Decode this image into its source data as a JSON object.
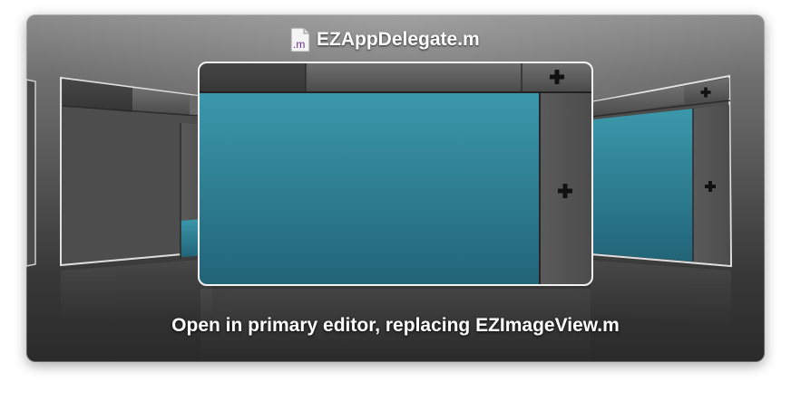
{
  "title_bar": {
    "file_icon": "objc-m-file-icon",
    "file_icon_label": ".m",
    "file_name": "EZAppDelegate.m"
  },
  "layouts": [
    {
      "name": "side-by-side-editor-layout",
      "position": "left",
      "editor_color": "#2f8ea1"
    },
    {
      "name": "primary-editor-layout",
      "position": "center",
      "selected": true,
      "editor_color": "#2f8ea1"
    },
    {
      "name": "assistant-editor-layout",
      "position": "right",
      "editor_color": "#2f8ea1"
    }
  ],
  "icons": {
    "add_tab": "plus-icon",
    "add_split": "plus-icon"
  },
  "colors": {
    "editor_teal": "#2f8ea1",
    "panel_dark": "#2a2a2a",
    "chrome_gray": "#5a5a5a"
  },
  "status": {
    "message": "Open in primary editor, replacing EZImageView.m"
  }
}
